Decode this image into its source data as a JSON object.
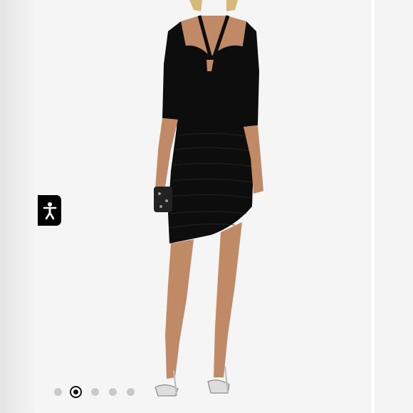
{
  "gallery": {
    "slide_count": 5,
    "active_index": 1,
    "colors": {
      "background": "#f5f5f5",
      "dress": "#0d0d0d",
      "skin": "#c08a66"
    }
  },
  "accessibility": {
    "icon": "accessibility-icon"
  }
}
